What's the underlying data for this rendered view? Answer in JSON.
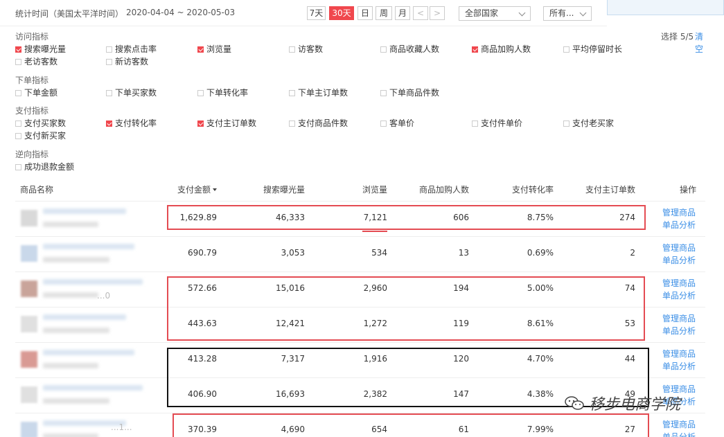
{
  "header": {
    "range_label": "统计时间（美国太平洋时间）",
    "range_dates": "2020-04-04 ~ 2020-05-03",
    "periods": [
      "7天",
      "30天",
      "日",
      "周",
      "月"
    ],
    "active_period": "30天",
    "prev_arrow": "<",
    "next_arrow": ">",
    "country_select": "全部国家",
    "other_select": "所有..."
  },
  "groups": [
    {
      "label": "访问指标",
      "options": [
        {
          "label": "搜索曝光量",
          "checked": true
        },
        {
          "label": "搜索点击率",
          "checked": false
        },
        {
          "label": "浏览量",
          "checked": true
        },
        {
          "label": "访客数",
          "checked": false
        },
        {
          "label": "商品收藏人数",
          "checked": false
        },
        {
          "label": "商品加购人数",
          "checked": true
        },
        {
          "label": "平均停留时长",
          "checked": false
        },
        {
          "label": "老访客数",
          "checked": false
        },
        {
          "label": "新访客数",
          "checked": false
        }
      ]
    },
    {
      "label": "下单指标",
      "options": [
        {
          "label": "下单金额",
          "checked": false
        },
        {
          "label": "下单买家数",
          "checked": false
        },
        {
          "label": "下单转化率",
          "checked": false
        },
        {
          "label": "下单主订单数",
          "checked": false
        },
        {
          "label": "下单商品件数",
          "checked": false
        }
      ]
    },
    {
      "label": "支付指标",
      "options": [
        {
          "label": "支付买家数",
          "checked": false
        },
        {
          "label": "支付转化率",
          "checked": true
        },
        {
          "label": "支付主订单数",
          "checked": true
        },
        {
          "label": "支付商品件数",
          "checked": false
        },
        {
          "label": "客单价",
          "checked": false
        },
        {
          "label": "支付件单价",
          "checked": false
        },
        {
          "label": "支付老买家",
          "checked": false
        },
        {
          "label": "支付新买家",
          "checked": false
        }
      ]
    },
    {
      "label": "逆向指标",
      "options": [
        {
          "label": "成功退款金额",
          "checked": false
        }
      ]
    }
  ],
  "selection": {
    "count_label": "选择 5/5",
    "clear_label": "清空"
  },
  "table": {
    "columns": [
      "商品名称",
      "支付金额",
      "搜索曝光量",
      "浏览量",
      "商品加购人数",
      "支付转化率",
      "支付主订单数",
      "操作"
    ],
    "sorted_column": "支付金额",
    "action_manage": "管理商品",
    "action_analyze": "单品分析",
    "rows": [
      [
        "1,629.89",
        "46,333",
        "7,121",
        "606",
        "8.75%",
        "274"
      ],
      [
        "690.79",
        "3,053",
        "534",
        "13",
        "0.69%",
        "2"
      ],
      [
        "572.66",
        "15,016",
        "2,960",
        "194",
        "5.00%",
        "74"
      ],
      [
        "443.63",
        "12,421",
        "1,272",
        "119",
        "8.61%",
        "53"
      ],
      [
        "413.28",
        "7,317",
        "1,916",
        "120",
        "4.70%",
        "44"
      ],
      [
        "406.90",
        "16,693",
        "2,382",
        "147",
        "4.38%",
        "49"
      ],
      [
        "370.39",
        "4,690",
        "654",
        "61",
        "7.99%",
        "27"
      ]
    ],
    "partial_codes": [
      "",
      "",
      "...0",
      "",
      "",
      "",
      "...1..."
    ]
  },
  "colors": {
    "accent": "#f0474d",
    "link": "#3a8ee6",
    "highlight_red": "#e44b52",
    "highlight_black": "#111111"
  },
  "watermark": {
    "text": "移步电商学院",
    "icon": "wechat-icon"
  }
}
